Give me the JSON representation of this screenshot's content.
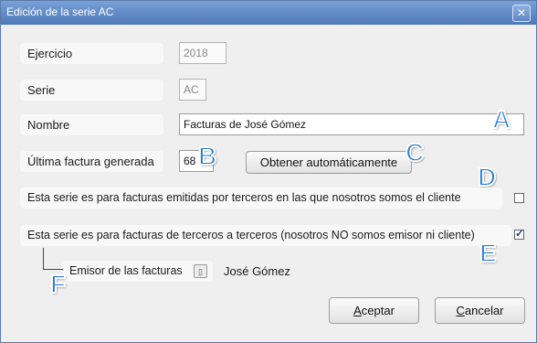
{
  "window": {
    "title": "Edición de la serie AC",
    "close_glyph": "✕"
  },
  "form": {
    "ejercicio_label": "Ejercicio",
    "ejercicio_value": "2018",
    "serie_label": "Serie",
    "serie_value": "AC",
    "nombre_label": "Nombre",
    "nombre_value": "Facturas de José Gómez",
    "ultima_label": "Última factura generada",
    "ultima_value": "68",
    "obtener_button": "Obtener automáticamente",
    "terceros_cliente_label": "Esta serie es para facturas emitidas por terceros en las que nosotros somos el cliente",
    "terceros_cliente_checked": false,
    "terceros_terceros_label": "Esta serie es para facturas de terceros a terceros (nosotros NO somos emisor ni cliente)",
    "terceros_terceros_checked": true,
    "emisor_label": "Emisor de las facturas",
    "emisor_value": "José Gómez"
  },
  "buttons": {
    "accept": "Aceptar",
    "cancel": "Cancelar"
  },
  "markers": [
    "A",
    "B",
    "C",
    "D",
    "E",
    "F"
  ],
  "colors": {
    "marker": "#2a7ad8",
    "titlebar": "#5a84c2"
  }
}
